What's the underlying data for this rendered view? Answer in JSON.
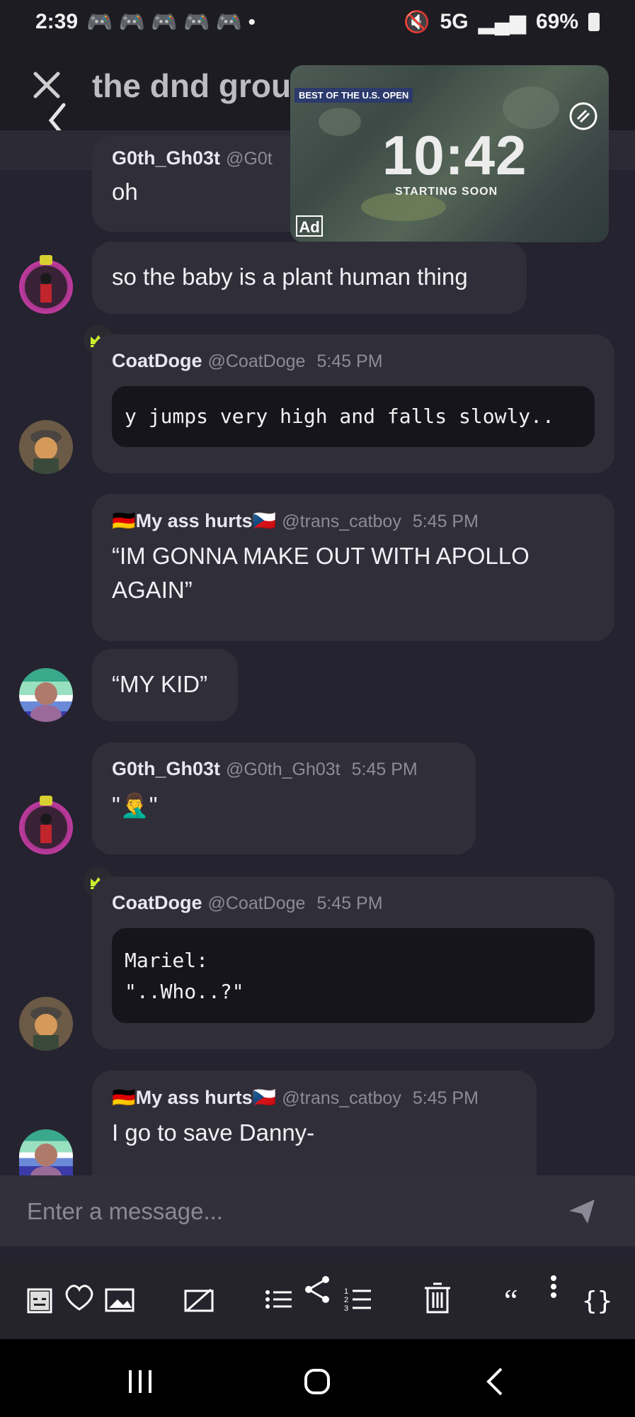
{
  "status": {
    "time": "2:39",
    "battery": "69%",
    "network": "5G"
  },
  "header": {
    "title": "the dnd group"
  },
  "ad": {
    "badge": "BEST OF THE U.S. OPEN",
    "countdown": "10:42",
    "subtitle": "STARTING SOON",
    "label": "Ad"
  },
  "messages": [
    {
      "author": "G0th_Gh03t",
      "handle": "@G0t",
      "text": "oh"
    },
    {
      "text": "so the baby is a plant human thing"
    },
    {
      "author": "CoatDoge",
      "handle": "@CoatDoge",
      "time": "5:45 PM",
      "code": "y jumps very high and falls slowly.."
    },
    {
      "author": "🇩🇪My ass hurts🇨🇿",
      "handle": "@trans_catboy",
      "time": "5:45 PM",
      "text": "“IM GONNA MAKE OUT WITH APOLLO AGAIN”"
    },
    {
      "text": "“MY KID”"
    },
    {
      "author": "G0th_Gh03t",
      "handle": "@G0th_Gh03t",
      "time": "5:45 PM",
      "text": "\"🤦‍♂️\""
    },
    {
      "author": "CoatDoge",
      "handle": "@CoatDoge",
      "time": "5:45 PM",
      "code_line1": "Mariel:",
      "code_line2": "\"..Who..?\""
    },
    {
      "author": "🇩🇪My ass hurts🇨🇿",
      "handle": "@trans_catboy",
      "time": "5:45 PM",
      "text": "I go to save Danny-"
    }
  ],
  "composer": {
    "placeholder": "Enter a message..."
  },
  "toolbar": {
    "icons": [
      "spoiler-icon",
      "heart-icon",
      "image-icon",
      "strikethrough-icon",
      "bullet-list-icon",
      "share-icon",
      "numbered-list-icon",
      "trash-icon",
      "quote-icon",
      "more-icon",
      "code-block-icon"
    ]
  },
  "colors": {
    "background": "#25232f",
    "bubble": "#302e38",
    "code": "#16151c",
    "crown": "#c9ef2f"
  }
}
